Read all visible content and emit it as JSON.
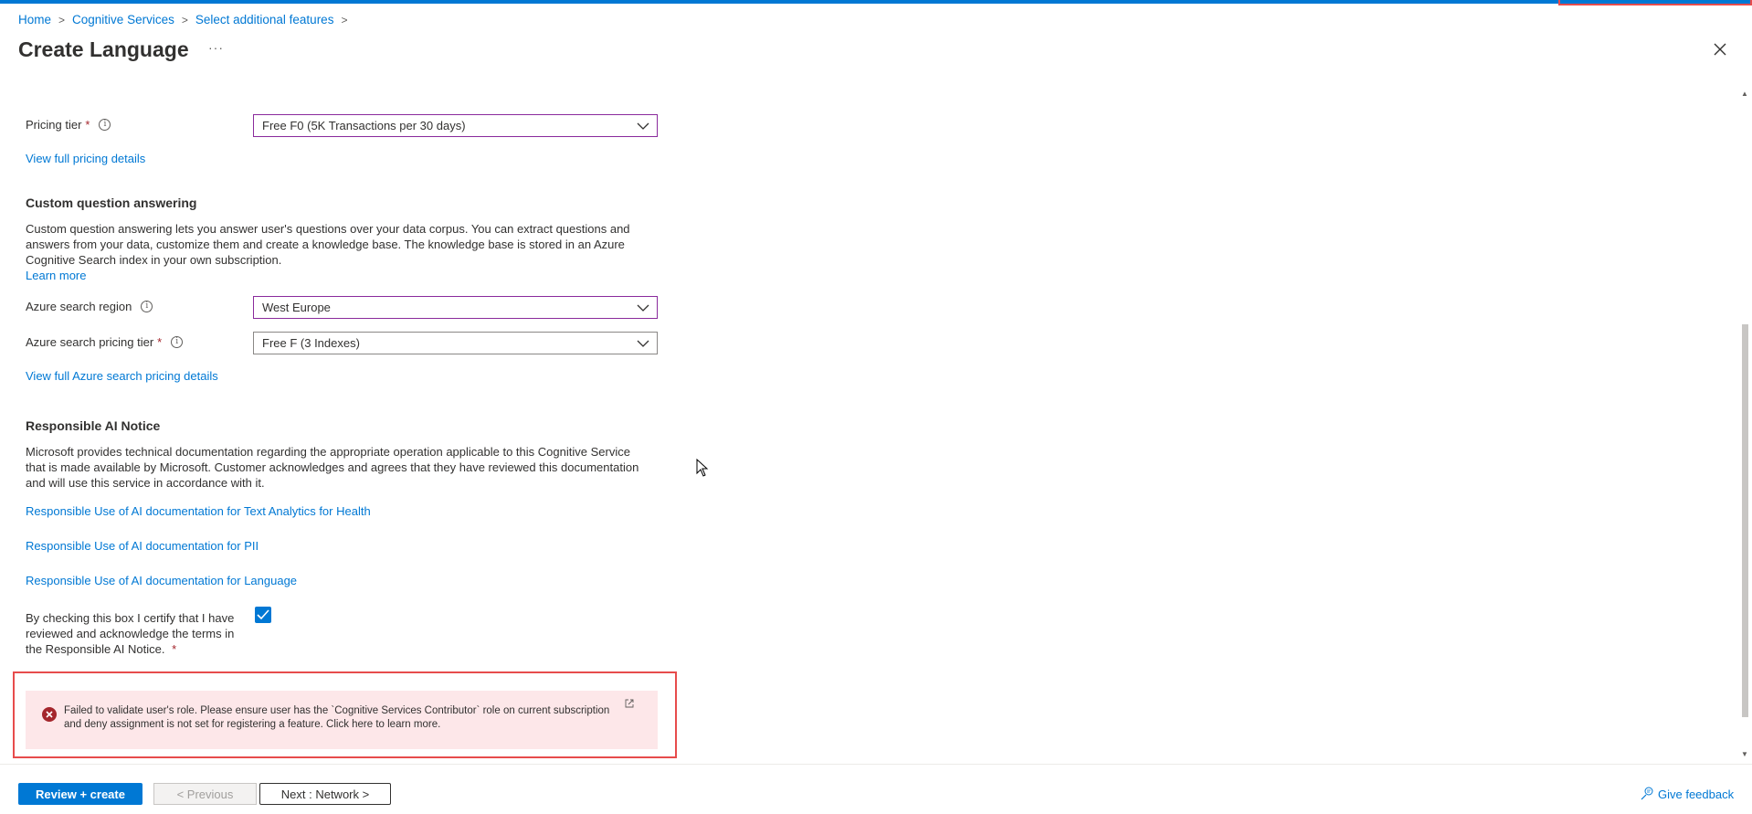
{
  "breadcrumb": {
    "home": "Home",
    "cognitive": "Cognitive Services",
    "features": "Select additional features",
    "sep": ">"
  },
  "header": {
    "title": "Create Language",
    "more": "···"
  },
  "pricing": {
    "label": "Pricing tier",
    "required": "*",
    "value": "Free F0 (5K Transactions per 30 days)",
    "details_link": "View full pricing details"
  },
  "cqa": {
    "heading": "Custom question answering",
    "line1": "Custom question answering lets you answer user's questions over your data corpus. You can extract questions and",
    "line2": "answers from your data, customize them and create a knowledge base. The knowledge base is stored in an Azure",
    "line3": "Cognitive Search index in your own subscription.",
    "learn_more": "Learn more",
    "region_label": "Azure search region",
    "region_value": "West Europe",
    "tier_label": "Azure search pricing tier",
    "tier_required": "*",
    "tier_value": "Free F (3 Indexes)",
    "tier_link": "View full Azure search pricing details"
  },
  "rai": {
    "heading": "Responsible AI Notice",
    "line1": "Microsoft provides technical documentation regarding the appropriate operation applicable to this Cognitive Service",
    "line2": "that is made available by Microsoft. Customer acknowledges and agrees that they have reviewed this documentation",
    "line3": "and will use this service in accordance with it.",
    "link_health": "Responsible Use of AI documentation for Text Analytics for Health",
    "link_pii": "Responsible Use of AI documentation for PII",
    "link_language": "Responsible Use of AI documentation for Language",
    "check_line1": "By checking this box I certify that I have",
    "check_line2": "reviewed and acknowledge the terms in",
    "check_line3": "the Responsible AI Notice.",
    "check_required": "*",
    "checked": true
  },
  "error": {
    "line1": "Failed to validate user's role. Please ensure user has the `Cognitive Services Contributor` role on current subscription",
    "line2": "and deny assignment is not set for registering a feature. Click here to learn more."
  },
  "footer": {
    "review_create": "Review + create",
    "previous": "< Previous",
    "next": "Next : Network >",
    "feedback": "Give feedback"
  },
  "colors": {
    "accent": "#0078d4",
    "error": "#a4262c",
    "error_bg": "#fde7e9",
    "highlight": "#e74c4c",
    "focus_border": "#8a2a9c"
  },
  "icons": [
    "info-icon",
    "chevron-down-icon",
    "close-icon",
    "error-icon",
    "external-link-icon",
    "checkmark-icon",
    "feedback-icon",
    "cursor-icon"
  ]
}
